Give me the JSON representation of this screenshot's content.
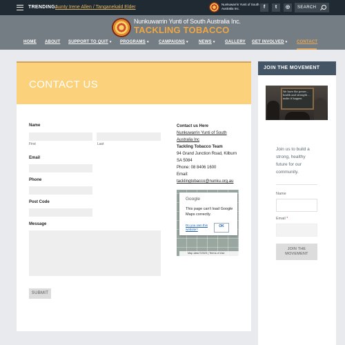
{
  "topbar": {
    "trending_label": "TRENDING:",
    "trending_link": "Aunty Irene Allen / Tanganekald Elder",
    "org_small": "Nunkuwarrin Yunti of South Australia Inc.",
    "social": [
      {
        "name": "facebook-icon",
        "glyph": "f"
      },
      {
        "name": "twitter-icon",
        "glyph": "🐦"
      },
      {
        "name": "instagram-icon",
        "glyph": "◎"
      }
    ],
    "search_label": "SEARCH"
  },
  "header": {
    "org_name": "Nunkuwarrin Yunti of South Australia Inc.",
    "tagline": "TACKLING TOBACCO",
    "nav": [
      {
        "label": "HOME",
        "has_dropdown": false
      },
      {
        "label": "ABOUT",
        "has_dropdown": false
      },
      {
        "label": "SUPPORT TO QUIT",
        "has_dropdown": true
      },
      {
        "label": "PROGRAMS",
        "has_dropdown": true
      },
      {
        "label": "CAMPAIGNS",
        "has_dropdown": true
      },
      {
        "label": "NEWS",
        "has_dropdown": true
      },
      {
        "label": "GALLERY",
        "has_dropdown": false
      },
      {
        "label": "GET INVOLVED",
        "has_dropdown": true
      },
      {
        "label": "CONTACT",
        "has_dropdown": false,
        "active": true
      }
    ]
  },
  "main": {
    "title": "CONTACT US",
    "form": {
      "name_label": "Name",
      "first_sublabel": "First",
      "last_sublabel": "Last",
      "email_label": "Email",
      "phone_label": "Phone",
      "postcode_label": "Post Code",
      "message_label": "Message",
      "submit_label": "SUBMIT"
    },
    "contact": {
      "heading": "Contact us Here",
      "org_link": "Nunkuwarrin Yunti of South Australia Inc",
      "team": "Tackling Tobacco Team",
      "address": "94 Grand Junction Road, Kilburn SA 5084",
      "phone": "Phone: 08 8406 1600",
      "email_label": "Email:",
      "email": "tacklingtobacco@nunku.org.au"
    },
    "map": {
      "brand": "Google",
      "message": "This page can't load Google Maps correctly.",
      "own_link": "Do you own this website?",
      "ok_label": "OK",
      "footer": "Map data ©2023  |  Terms of Use"
    }
  },
  "sidebar": {
    "header": "JOIN THE MOVEMENT",
    "blurb": "Join us to build a strong, healthy future for our community.",
    "name_label": "Name",
    "email_label": "Email",
    "required_mark": "*",
    "button_label": "JOIN THE MOVEMENT",
    "photo_chalk": "We have the power... health and strength ... make it happen"
  },
  "colors": {
    "topbar": "#1f2a33",
    "header": "#757d84",
    "accent": "#f0a640",
    "hero": "#fbd27b",
    "sidebar_header": "#445566"
  }
}
